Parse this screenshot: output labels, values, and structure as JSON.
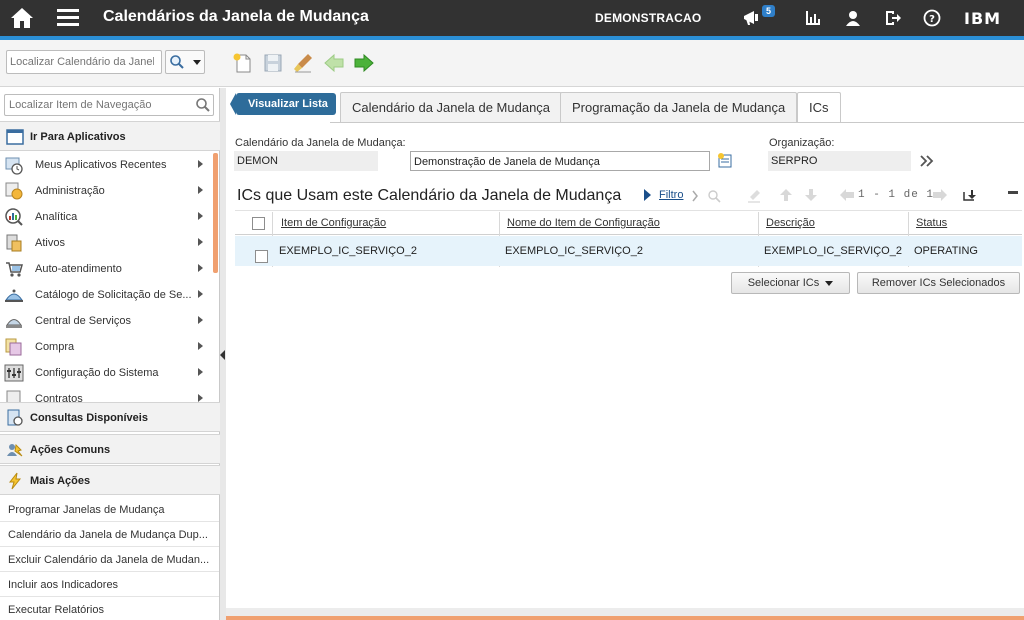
{
  "header": {
    "title": "Calendários da Janela de Mudança",
    "user": "DEMONSTRACAO",
    "notifications": "5",
    "brand": "IBM"
  },
  "toolbar": {
    "search_placeholder": "Localizar Calendário da Janela"
  },
  "sidebar": {
    "nav_search_placeholder": "Localizar Item de Navegação",
    "go_to_apps": "Ir Para Aplicativos",
    "apps": [
      {
        "label": "Meus Aplicativos Recentes",
        "icon": "recent-apps-icon"
      },
      {
        "label": "Administração",
        "icon": "administration-icon"
      },
      {
        "label": "Analítica",
        "icon": "analytics-icon"
      },
      {
        "label": "Ativos",
        "icon": "assets-icon"
      },
      {
        "label": "Auto-atendimento",
        "icon": "self-service-icon"
      },
      {
        "label": "Catálogo de Solicitação de Se...",
        "icon": "service-catalog-icon"
      },
      {
        "label": "Central de Serviços",
        "icon": "service-desk-icon"
      },
      {
        "label": "Compra",
        "icon": "purchasing-icon"
      },
      {
        "label": "Configuração do Sistema",
        "icon": "system-configuration-icon"
      },
      {
        "label": "Contratos",
        "icon": "contracts-icon"
      }
    ],
    "queries": "Consultas Disponíveis",
    "common_actions": "Ações Comuns",
    "more_actions": "Mais Ações",
    "actions": [
      "Programar Janelas de Mudança",
      "Calendário da Janela de Mudança Dup...",
      "Excluir Calendário da Janela de Mudan...",
      "Incluir aos Indicadores",
      "Executar Relatórios"
    ]
  },
  "main": {
    "list_view_button": "Visualizar Lista",
    "tabs": [
      "Calendário da Janela de Mudança",
      "Programação da Janela de Mudança",
      "ICs"
    ],
    "active_tab": "ICs",
    "fields": {
      "calendar_label": "Calendário da Janela de Mudança:",
      "calendar_value": "DEMON",
      "description_value": "Demonstração de Janela de Mudança",
      "org_label": "Organização:",
      "org_value": "SERPRO"
    },
    "section_title": "ICs que Usam este Calendário da Janela de Mudança",
    "filter_label": "Filtro",
    "pager": "1 - 1 de 1",
    "columns": [
      "Item de Configuração",
      "Nome do Item de Configuração",
      "Descrição",
      "Status"
    ],
    "rows": [
      [
        "EXEMPLO_IC_SERVIÇO_2",
        "EXEMPLO_IC_SERVIÇO_2",
        "EXEMPLO_IC_SERVIÇO_2",
        "OPERATING"
      ]
    ],
    "select_button": "Selecionar ICs",
    "remove_button": "Remover ICs Selecionados"
  },
  "colors": {
    "topbar": "#323232",
    "accent_blue": "#2b8fd6",
    "accent_orange": "#f0a070",
    "row_highlight": "#e6f3fb"
  }
}
